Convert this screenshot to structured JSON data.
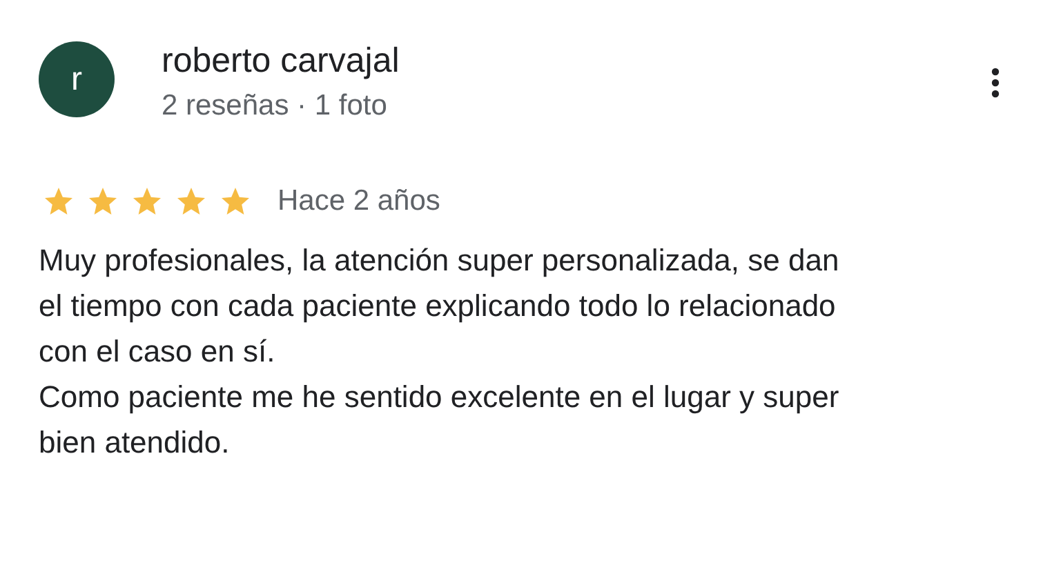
{
  "review": {
    "avatar_letter": "r",
    "author": "roberto carvajal",
    "meta": "2 reseñas · 1 foto",
    "stars": 5,
    "time": "Hace 2 años",
    "paragraphs": [
      "Muy profesionales, la atención super personalizada, se dan el tiempo con cada paciente explicando todo lo relacionado con el caso en sí.",
      "Como paciente me he sentido excelente en el lugar y super bien atendido."
    ]
  }
}
